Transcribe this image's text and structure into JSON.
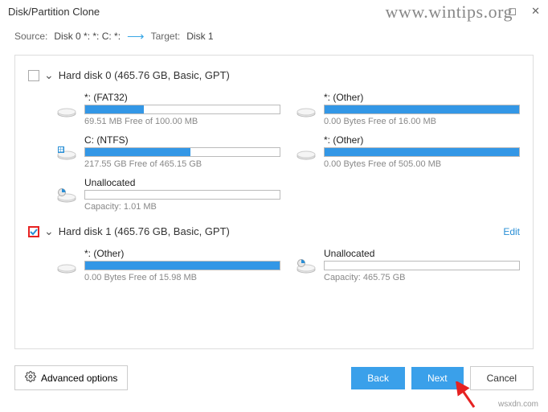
{
  "window": {
    "title": "Disk/Partition Clone"
  },
  "watermark": "www.wintips.org",
  "credit": "wsxdn.com",
  "sourceRow": {
    "sourceLabel": "Source:",
    "sourceValue": "Disk 0 *: *: C: *:",
    "targetLabel": "Target:",
    "targetValue": "Disk 1"
  },
  "disks": [
    {
      "checked": false,
      "highlightCheck": false,
      "title": "Hard disk 0 (465.76 GB, Basic, GPT)",
      "editLabel": "",
      "partitions": [
        {
          "label": "*: (FAT32)",
          "fillPct": 30,
          "sub": "69.51 MB Free of 100.00 MB",
          "iconType": "drive"
        },
        {
          "label": "*: (Other)",
          "fillPct": 100,
          "sub": "0.00 Bytes Free of 16.00 MB",
          "iconType": "drive"
        },
        {
          "label": "C: (NTFS)",
          "fillPct": 54,
          "sub": "217.55 GB Free of 465.15 GB",
          "iconType": "windrive"
        },
        {
          "label": "*: (Other)",
          "fillPct": 100,
          "sub": "0.00 Bytes Free of 505.00 MB",
          "iconType": "drive"
        },
        {
          "label": "Unallocated",
          "fillPct": 0,
          "sub": "Capacity: 1.01 MB",
          "iconType": "pie"
        }
      ]
    },
    {
      "checked": true,
      "highlightCheck": true,
      "title": "Hard disk 1 (465.76 GB, Basic, GPT)",
      "editLabel": "Edit",
      "partitions": [
        {
          "label": "*: (Other)",
          "fillPct": 100,
          "sub": "0.00 Bytes Free of 15.98 MB",
          "iconType": "drive"
        },
        {
          "label": "Unallocated",
          "fillPct": 0,
          "sub": "Capacity: 465.75 GB",
          "iconType": "pie"
        }
      ]
    }
  ],
  "footer": {
    "advanced": "Advanced options",
    "back": "Back",
    "next": "Next",
    "cancel": "Cancel"
  }
}
